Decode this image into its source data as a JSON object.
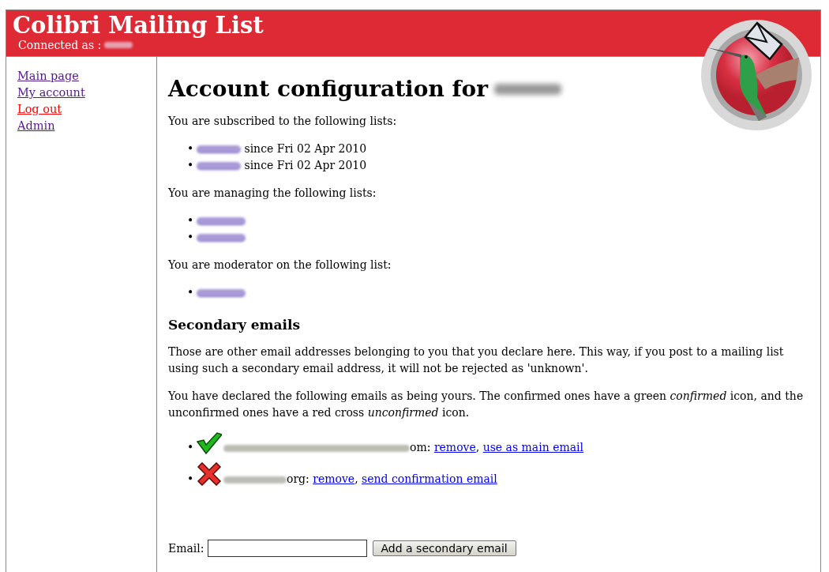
{
  "header": {
    "title": "Colibri Mailing List",
    "connected_label": "Connected as :"
  },
  "nav": [
    {
      "label": "Main page",
      "highlighted": false
    },
    {
      "label": "My account",
      "highlighted": false
    },
    {
      "label": "Log out",
      "highlighted": true
    },
    {
      "label": "Admin",
      "highlighted": false
    }
  ],
  "content": {
    "heading": "Account configuration for",
    "subscribed_intro": "You are subscribed to the following lists:",
    "subscribed": [
      {
        "bullet": "•",
        "since": "since Fri 02 Apr 2010"
      },
      {
        "bullet": "•",
        "since": "since Fri 02 Apr 2010"
      }
    ],
    "managing_intro": "You are managing the following lists:",
    "managing": [
      {
        "bullet": "•",
        "kind": "redacted-link"
      },
      {
        "bullet": "•",
        "kind": "redacted-link"
      }
    ],
    "moderator_intro": "You are moderator on the following list:",
    "moderating": [
      {
        "bullet": "•",
        "kind": "redacted-link"
      }
    ],
    "secondary_heading": "Secondary emails",
    "secondary_text": "Those are other email addresses belonging to you that you declare here. This way, if you post to a mailing list using such a secondary email address, it will not be rejected as 'unknown'.",
    "declared_text": "You have declared the following emails as being yours. The confirmed ones have a green *confirmed* icon, and the unconfirmed ones have a red cross *unconfirmed* icon.",
    "emails": [
      {
        "bullet": "•",
        "confirmed": true,
        "suffix": "om:",
        "actions": [
          {
            "label": "remove",
            "separator": ","
          },
          {
            "label": "use as main email"
          }
        ]
      },
      {
        "bullet": "•",
        "confirmed": false,
        "suffix": "org:",
        "actions": [
          {
            "label": "remove",
            "separator": ","
          },
          {
            "label": "send confirmation email"
          }
        ]
      }
    ],
    "form": {
      "label": "Email:",
      "button": "Add a secondary email"
    }
  }
}
